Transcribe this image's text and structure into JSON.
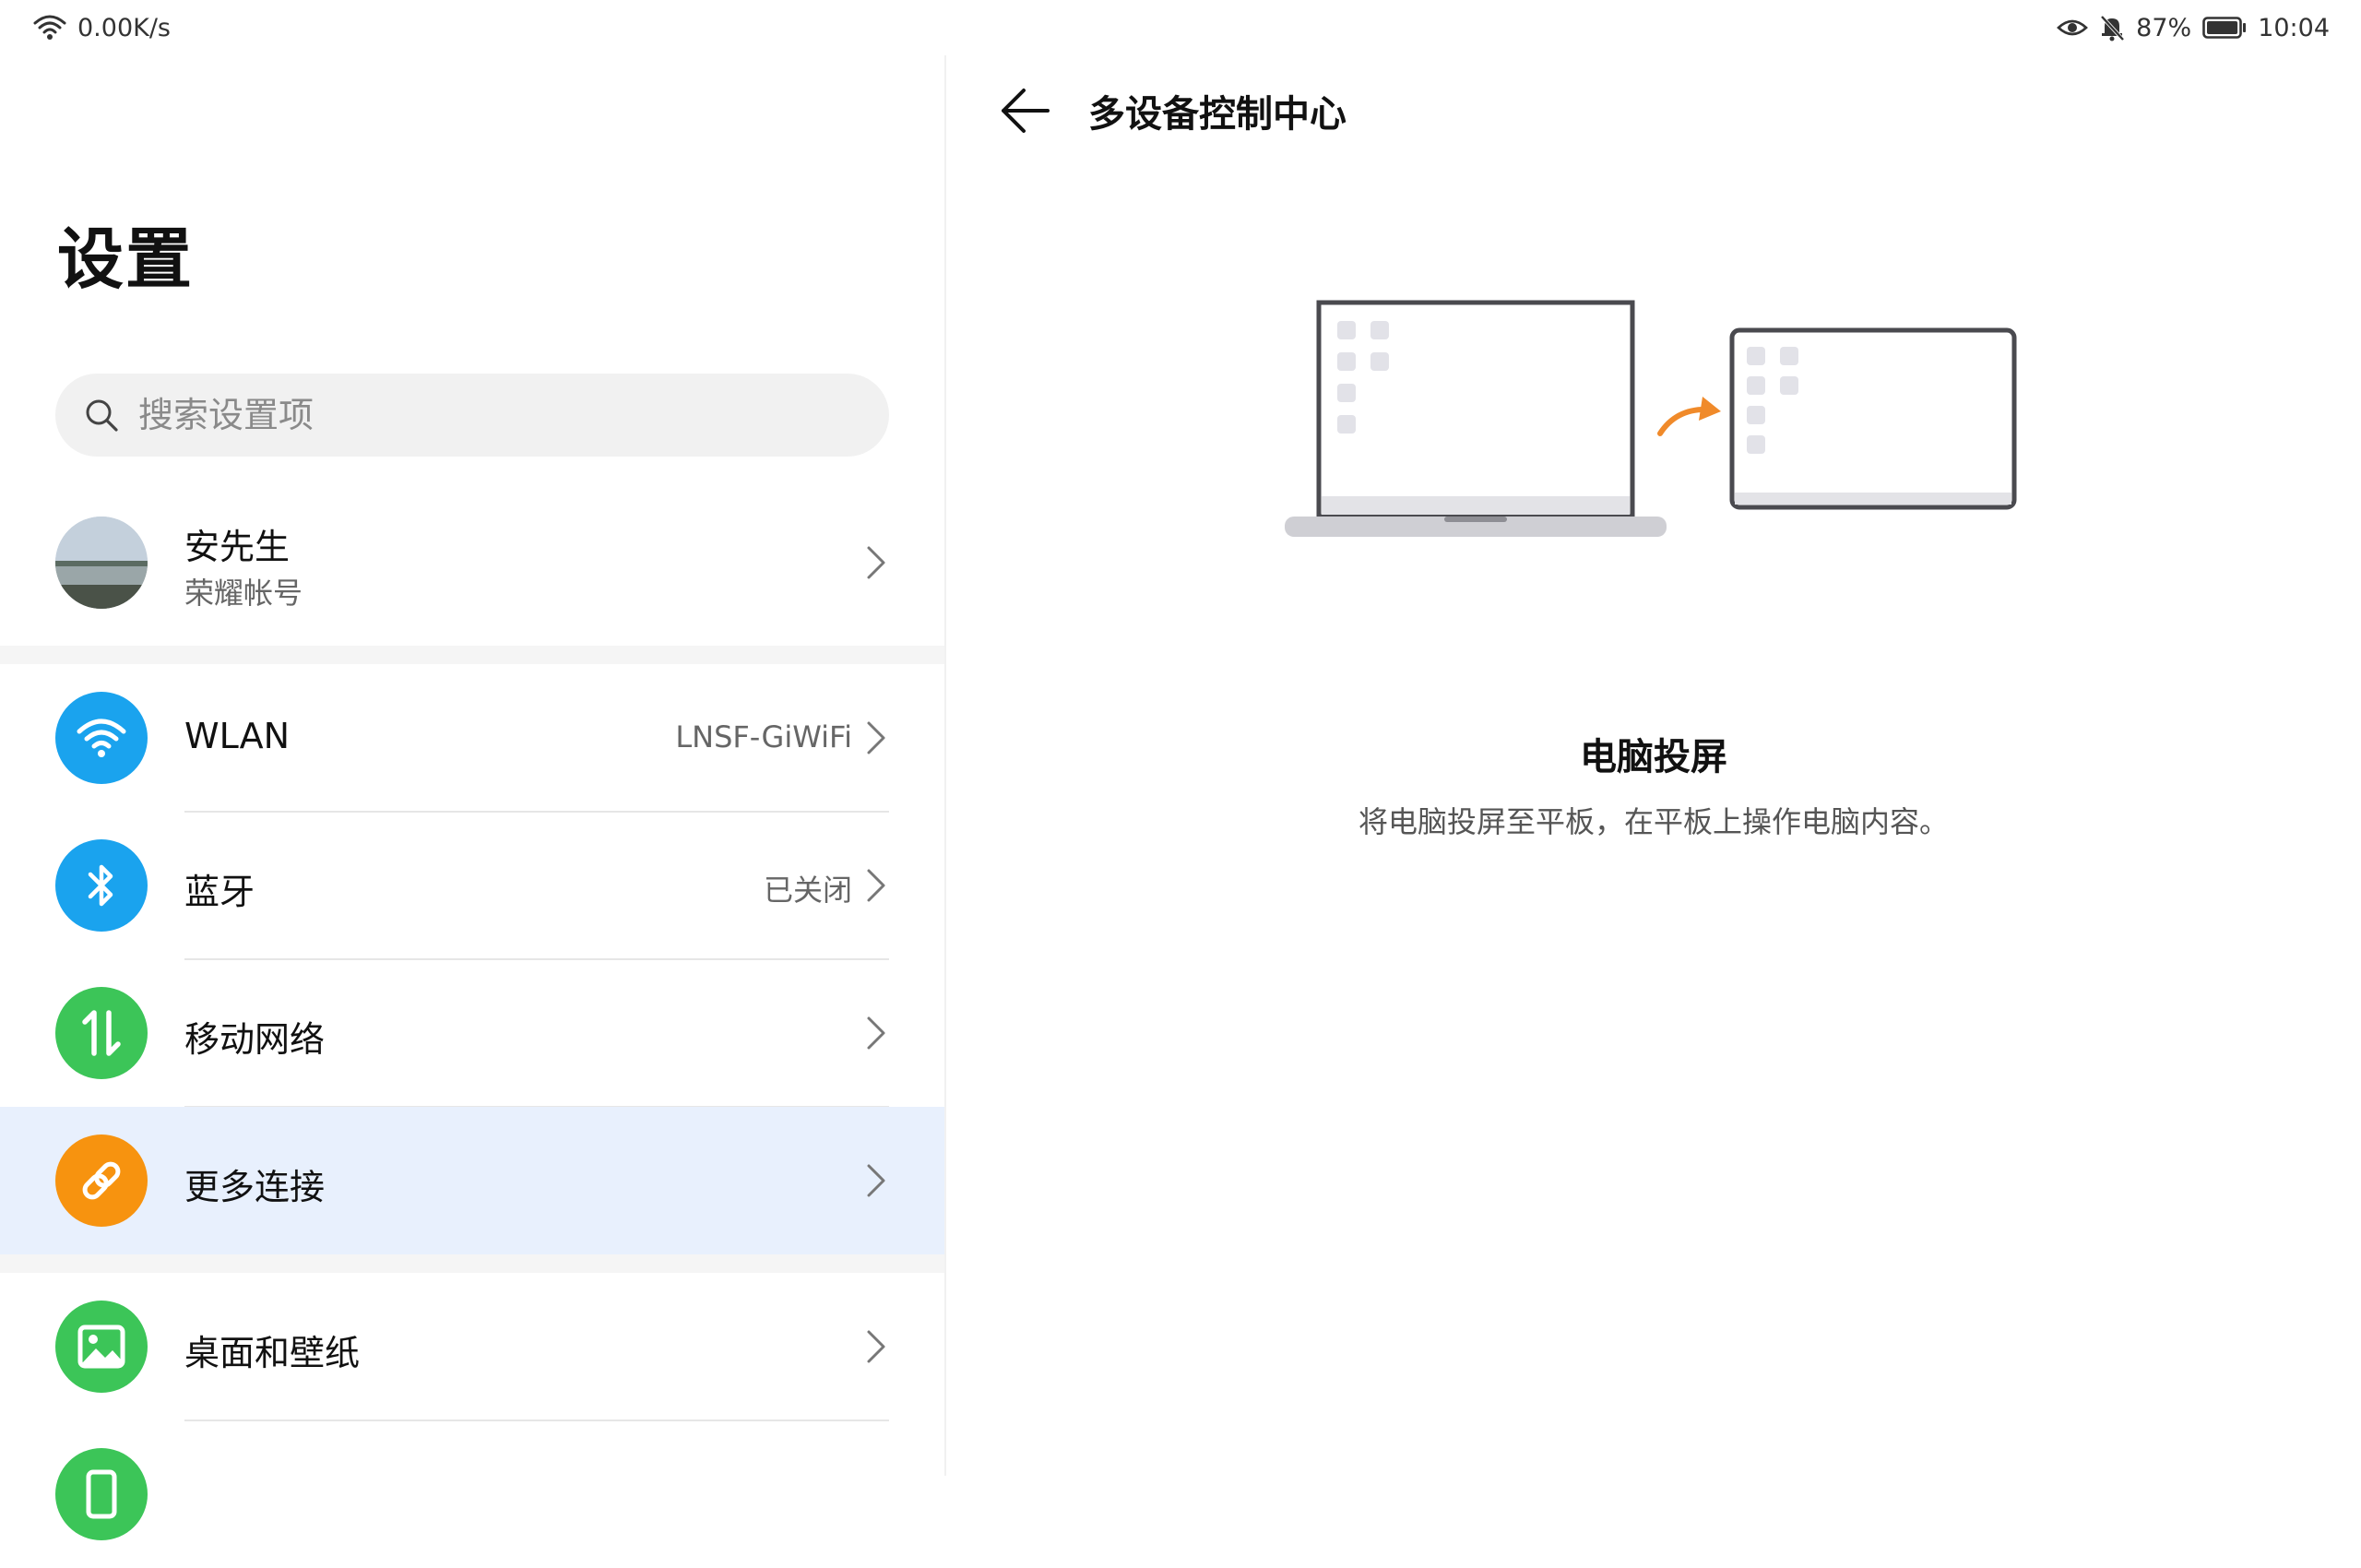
{
  "status_bar": {
    "net_speed": "0.00K/s",
    "battery_percent": "87%",
    "time": "10:04",
    "battery_level": 0.87
  },
  "settings": {
    "title": "设置",
    "search_placeholder": "搜索设置项",
    "account": {
      "name": "安先生",
      "subtitle": "荣耀帐号"
    },
    "items": [
      {
        "label": "WLAN",
        "value": "LNSF-GiWiFi",
        "icon": "wifi-icon",
        "color": "#1aa3ee"
      },
      {
        "label": "蓝牙",
        "value": "已关闭",
        "icon": "bluetooth-icon",
        "color": "#1aa3ee"
      },
      {
        "label": "移动网络",
        "value": "",
        "icon": "mobile-data-icon",
        "color": "#3cc558"
      },
      {
        "label": "更多连接",
        "value": "",
        "icon": "link-icon",
        "color": "#f7930f"
      },
      {
        "label": "桌面和壁纸",
        "value": "",
        "icon": "wallpaper-icon",
        "color": "#3cc558"
      }
    ]
  },
  "detail": {
    "title": "多设备控制中心",
    "feature_title": "电脑投屏",
    "feature_desc": "将电脑投屏至平板，在平板上操作电脑内容。"
  },
  "colors": {
    "accent": "#1aa3ee",
    "active_row": "#e8f0fd",
    "arrow": "#f08a2a"
  }
}
